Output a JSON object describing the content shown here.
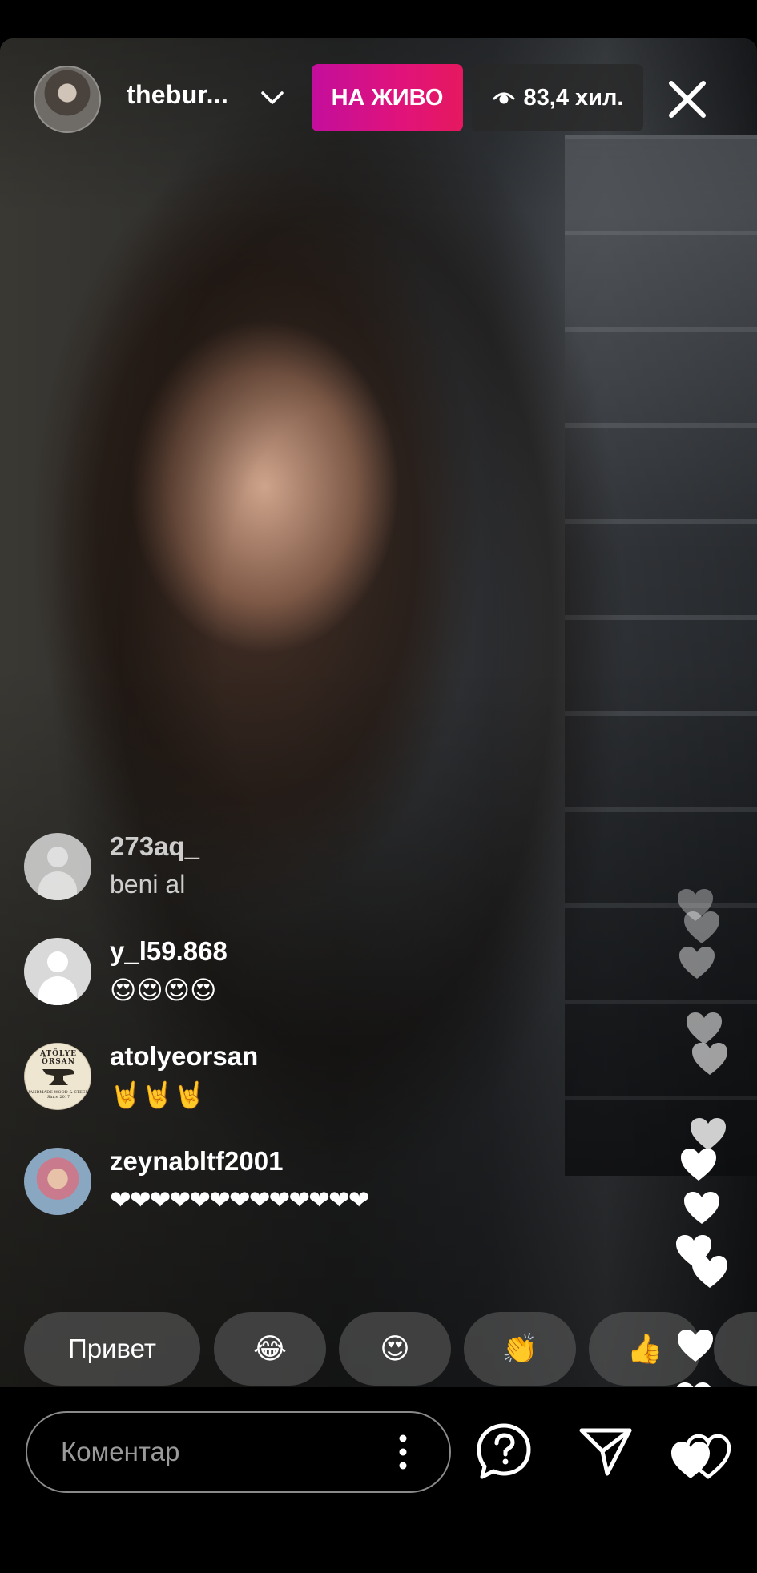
{
  "header": {
    "host_username": "thebur...",
    "live_label": "НА ЖИВО",
    "viewer_count": "83,4 хил.",
    "icons": {
      "host_avatar": "profile-photo",
      "switch": "chevron-down-icon",
      "viewers": "eye-icon",
      "close": "close-icon"
    }
  },
  "comments": [
    {
      "username": "273aq_",
      "text": "beni al",
      "avatar": "default-avatar"
    },
    {
      "username": "y_l59.868",
      "text": "😍😍😍😍",
      "avatar": "default-avatar"
    },
    {
      "username": "atolyeorsan",
      "text": "🤘🤘🤘",
      "avatar": "brand-logo",
      "avatar_text_top": "ATÖLYE ÖRSAN",
      "avatar_text_bottom": "HANDMADE WOOD & STEEL · Since 2017"
    },
    {
      "username": "zeynabltf2001",
      "text": "❤❤❤❤❤❤❤❤❤❤❤❤❤",
      "avatar": "profile-photo"
    }
  ],
  "quick_reactions": [
    {
      "label": "Привет"
    },
    {
      "label": "😂"
    },
    {
      "label": "😍"
    },
    {
      "label": "👏"
    },
    {
      "label": "👍"
    }
  ],
  "bottom_bar": {
    "comment_placeholder": "Коментар",
    "icons": {
      "more": "more-vertical-icon",
      "questions": "question-bubble-icon",
      "share": "send-icon",
      "like": "heart-icon"
    }
  },
  "colors": {
    "live_badge_start": "#c30e9c",
    "live_badge_end": "#e5185f",
    "comment_hearts": "#e0112a",
    "overlay_chip": "#5a5a5a"
  }
}
